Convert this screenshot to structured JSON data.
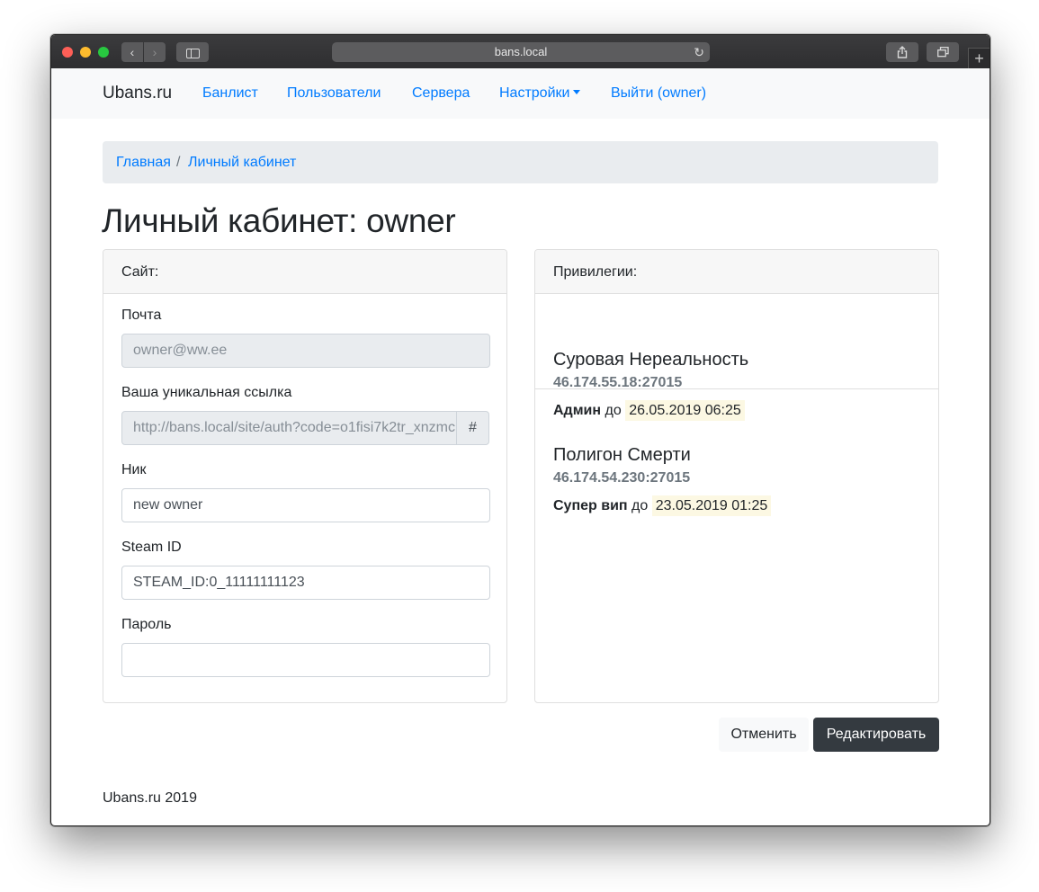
{
  "browser": {
    "url": "bans.local",
    "back_glyph": "‹",
    "forward_glyph": "›",
    "reload_glyph": "↻",
    "new_tab_glyph": "+"
  },
  "navbar": {
    "brand": "Ubans.ru",
    "links": [
      "Банлист",
      "Пользователи",
      "Сервера",
      "Настройки",
      "Выйти (owner)"
    ]
  },
  "breadcrumb": {
    "items": [
      "Главная",
      "Личный кабинет"
    ],
    "separator": "/"
  },
  "page_title": "Личный кабинет: owner",
  "site_card": {
    "header": "Сайт:",
    "fields": {
      "email": {
        "label": "Почта",
        "value": "owner@ww.ee"
      },
      "link": {
        "label": "Ваша уникальная ссылка",
        "value": "http://bans.local/site/auth?code=o1fisi7k2tr_xnzmc",
        "addon": "#"
      },
      "nick": {
        "label": "Ник",
        "value": "new owner"
      },
      "steam": {
        "label": "Steam ID",
        "value": "STEAM_ID:0_11111111123"
      },
      "password": {
        "label": "Пароль",
        "value": ""
      }
    }
  },
  "privileges_card": {
    "header": "Привилегии:",
    "items": [
      {
        "server": "Суровая Нереальность",
        "ip": "46.174.55.18:27015",
        "role": "Админ",
        "until_word": "до",
        "date": "26.05.2019 06:25"
      },
      {
        "server": "Полигон Смерти",
        "ip": "46.174.54.230:27015",
        "role": "Супер вип",
        "until_word": "до",
        "date": "23.05.2019 01:25"
      }
    ]
  },
  "buttons": {
    "cancel": "Отменить",
    "edit": "Редактировать"
  },
  "footer": "Ubans.ru 2019",
  "colors": {
    "link": "#007bff",
    "navbar_bg": "#f8f9fa",
    "breadcrumb_bg": "#e9ecef",
    "highlight": "#fcf8e3",
    "primary_button": "#343a40"
  }
}
